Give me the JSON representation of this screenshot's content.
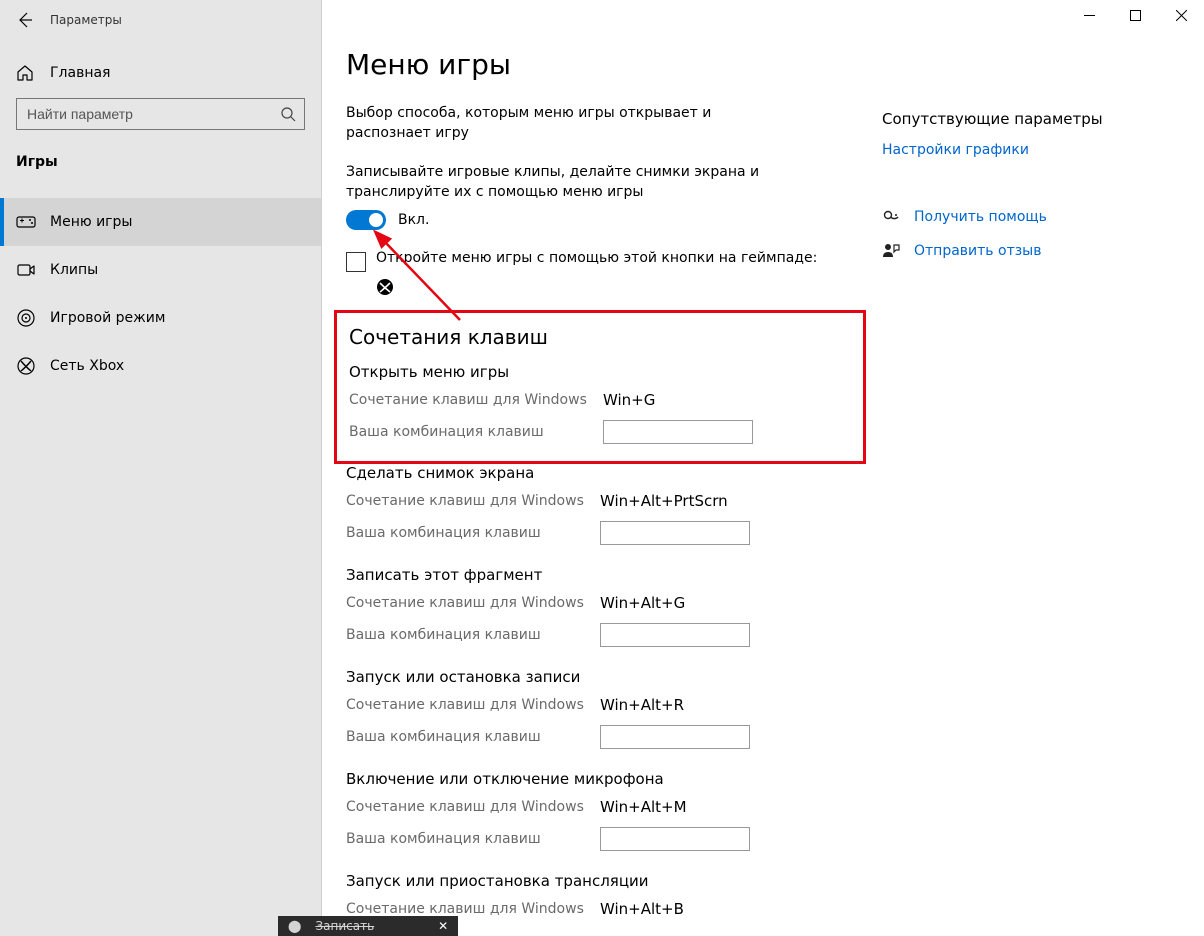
{
  "app_title": "Параметры",
  "titlebar": {
    "minimize": "—",
    "maximize": "▢",
    "close": "✕"
  },
  "sidebar": {
    "home": "Главная",
    "search_placeholder": "Найти параметр",
    "section_label": "Игры",
    "items": [
      {
        "label": "Меню игры",
        "icon": "game-menu-icon",
        "active": true
      },
      {
        "label": "Клипы",
        "icon": "clips-icon",
        "active": false
      },
      {
        "label": "Игровой режим",
        "icon": "game-mode-icon",
        "active": false
      },
      {
        "label": "Сеть Xbox",
        "icon": "xbox-icon",
        "active": false
      }
    ]
  },
  "main": {
    "title": "Меню игры",
    "desc1": "Выбор способа, которым меню игры открывает и распознает игру",
    "desc2": "Записывайте игровые клипы, делайте снимки экрана и транслируйте их с помощью меню игры",
    "toggle_label": "Вкл.",
    "checkbox_label": "Откройте меню игры с помощью этой кнопки на геймпаде:",
    "shortcuts_heading": "Сочетания клавиш",
    "windows_shortcut_label": "Сочетание клавиш для Windows",
    "custom_shortcut_label": "Ваша комбинация клавиш",
    "groups": [
      {
        "title": "Открыть меню игры",
        "win_combo": "Win+G"
      },
      {
        "title": "Сделать снимок экрана",
        "win_combo": "Win+Alt+PrtScrn"
      },
      {
        "title": "Записать этот фрагмент",
        "win_combo": "Win+Alt+G"
      },
      {
        "title": "Запуск или остановка записи",
        "win_combo": "Win+Alt+R"
      },
      {
        "title": "Включение или отключение микрофона",
        "win_combo": "Win+Alt+M"
      },
      {
        "title": "Запуск или приостановка трансляции",
        "win_combo": "Win+Alt+B"
      }
    ]
  },
  "right": {
    "related_heading": "Сопутствующие параметры",
    "graphics_link": "Настройки графики",
    "help_link": "Получить помощь",
    "feedback_link": "Отправить отзыв"
  },
  "bottom_fragment": "Записать"
}
